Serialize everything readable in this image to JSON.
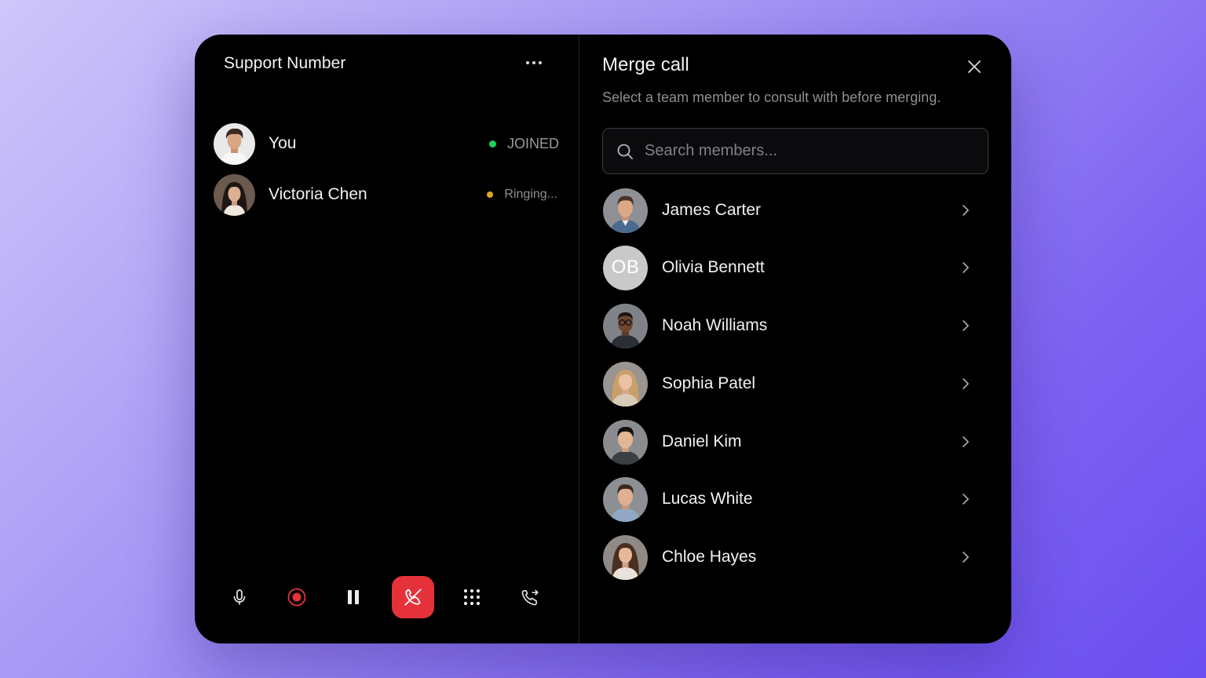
{
  "call": {
    "title": "Support Number",
    "participants": [
      {
        "name": "You",
        "status": "JOINED",
        "status_color": "#1fd15a",
        "status_text_color": "#9a9aa0",
        "avatar": "portrait-young-man-curly-hair"
      },
      {
        "name": "Victoria Chen",
        "status": "Ringing...",
        "status_color": "#e0a521",
        "status_text_color": "#8e8e94",
        "avatar": "portrait-woman-dark-hair"
      }
    ],
    "controls": [
      {
        "name": "mute",
        "icon": "microphone-icon"
      },
      {
        "name": "record",
        "icon": "record-icon",
        "color": "#e5323a"
      },
      {
        "name": "hold",
        "icon": "pause-icon"
      },
      {
        "name": "end-call",
        "icon": "phone-hangup-icon",
        "color": "#e5323a"
      },
      {
        "name": "keypad",
        "icon": "dialpad-icon"
      },
      {
        "name": "transfer",
        "icon": "phone-forward-icon"
      }
    ]
  },
  "merge": {
    "title": "Merge call",
    "subtitle": "Select a team member to consult with before merging.",
    "search_placeholder": "Search members...",
    "members": [
      {
        "name": "James Carter",
        "avatar": "portrait-man-short-hair"
      },
      {
        "name": "Olivia Bennett",
        "initials": "OB"
      },
      {
        "name": "Noah Williams",
        "avatar": "portrait-man-glasses"
      },
      {
        "name": "Sophia Patel",
        "avatar": "portrait-woman-blonde"
      },
      {
        "name": "Daniel Kim",
        "avatar": "portrait-man-black-hair"
      },
      {
        "name": "Lucas White",
        "avatar": "portrait-man-brown-hair"
      },
      {
        "name": "Chloe Hayes",
        "avatar": "portrait-woman-brown-hair"
      }
    ]
  },
  "colors": {
    "panel": "#000000",
    "accent_red": "#e5323a",
    "joined_green": "#1fd15a",
    "ringing_amber": "#e0a521"
  }
}
